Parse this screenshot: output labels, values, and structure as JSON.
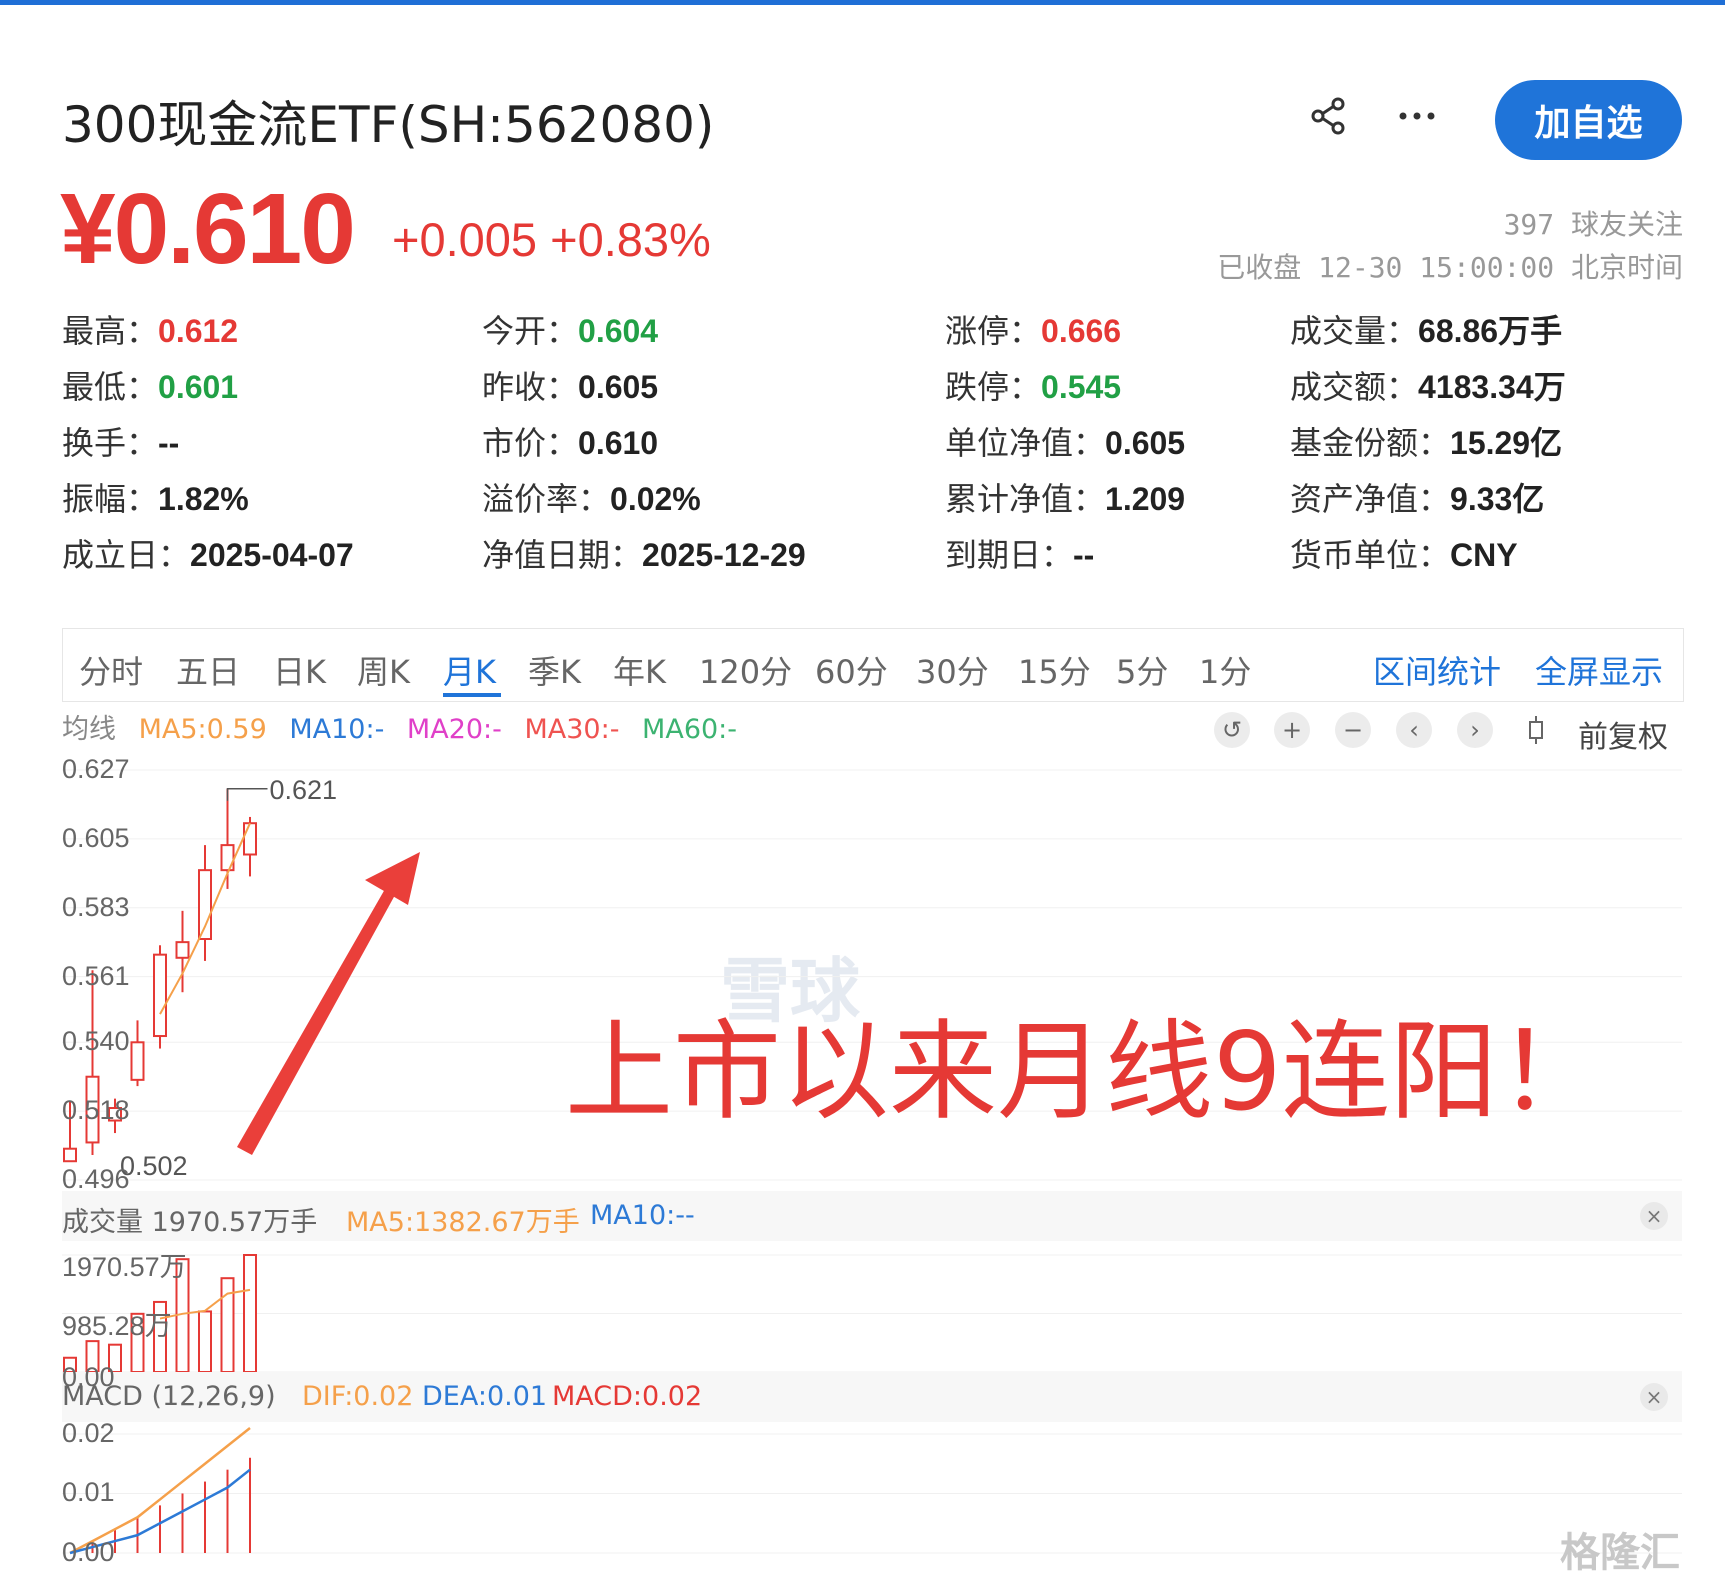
{
  "header": {
    "title": "300现金流ETF(SH:562080)",
    "add_label": "加自选",
    "share_icon": "share-icon",
    "more_icon": "more-icon",
    "price": "¥0.610",
    "change": "+0.005 +0.83%",
    "followers": "397 球友关注",
    "status": "已收盘 12-30 15:00:00 北京时间"
  },
  "stats": [
    {
      "label": "最高：",
      "value": "0.612",
      "color": "up"
    },
    {
      "label": "今开：",
      "value": "0.604",
      "color": "down"
    },
    {
      "label": "涨停：",
      "value": "0.666",
      "color": "up"
    },
    {
      "label": "成交量：",
      "value": "68.86万手",
      "color": "flat"
    },
    {
      "label": "最低：",
      "value": "0.601",
      "color": "down"
    },
    {
      "label": "昨收：",
      "value": "0.605",
      "color": "flat"
    },
    {
      "label": "跌停：",
      "value": "0.545",
      "color": "down"
    },
    {
      "label": "成交额：",
      "value": "4183.34万",
      "color": "flat"
    },
    {
      "label": "换手：",
      "value": "--",
      "color": "flat"
    },
    {
      "label": "市价：",
      "value": "0.610",
      "color": "flat"
    },
    {
      "label": "单位净值：",
      "value": "0.605",
      "color": "flat"
    },
    {
      "label": "基金份额：",
      "value": "15.29亿",
      "color": "flat"
    },
    {
      "label": "振幅：",
      "value": "1.82%",
      "color": "flat"
    },
    {
      "label": "溢价率：",
      "value": "0.02%",
      "color": "flat"
    },
    {
      "label": "累计净值：",
      "value": "1.209",
      "color": "flat"
    },
    {
      "label": "资产净值：",
      "value": "9.33亿",
      "color": "flat"
    },
    {
      "label": "成立日：",
      "value": "2025-04-07",
      "color": "flat"
    },
    {
      "label": "净值日期：",
      "value": "2025-12-29",
      "color": "flat"
    },
    {
      "label": "到期日：",
      "value": "--",
      "color": "flat"
    },
    {
      "label": "货币单位：",
      "value": "CNY",
      "color": "flat"
    }
  ],
  "tabs": [
    "分时",
    "五日",
    "日K",
    "周K",
    "月K",
    "季K",
    "年K",
    "120分",
    "60分",
    "30分",
    "15分",
    "5分",
    "1分"
  ],
  "active_tab": "月K",
  "tab_links": [
    "区间统计",
    "全屏显示"
  ],
  "ma_legend": {
    "label": "均线",
    "ma5": "MA5:0.59",
    "ma10": "MA10:-",
    "ma20": "MA20:-",
    "ma30": "MA30:-",
    "ma60": "MA60:-"
  },
  "toolbar": {
    "undo_icon": "undo-icon",
    "zoom_in_icon": "zoom-in-icon",
    "zoom_out_icon": "zoom-out-icon",
    "prev_icon": "chevron-left-icon",
    "next_icon": "chevron-right-icon",
    "candle_icon": "candle-icon",
    "adjust_label": "前复权"
  },
  "volume_panel": {
    "label": "成交量 1970.57万手",
    "ma5": "MA5:1382.67万手",
    "ma10": "MA10:--",
    "ticks": [
      "1970.57万",
      "985.28万",
      "0.00"
    ]
  },
  "macd_panel": {
    "label": "MACD (12,26,9)",
    "dif": "DIF:0.02",
    "dea": "DEA:0.01",
    "macd": "MACD:0.02",
    "ticks": [
      "0.02",
      "0.01",
      "0.00"
    ]
  },
  "annotation": "上市以来月线9连阳！",
  "watermark": "雪球",
  "logo": "格隆汇",
  "colors": {
    "up": "#e53935",
    "down": "#21a045",
    "accent": "#1f74d9",
    "ma5": "#f5a04a",
    "ma10": "#2d7ad6",
    "ma20": "#e040c8",
    "ma30": "#ef5350",
    "ma60": "#3cb371"
  },
  "chart_data": [
    {
      "type": "candlestick",
      "title": "",
      "y_ticks": [
        "0.627",
        "0.605",
        "0.583",
        "0.561",
        "0.540",
        "0.518",
        "0.496"
      ],
      "max_label": "0.621",
      "min_label": "0.502",
      "candles": [
        {
          "open": 0.502,
          "close": 0.506,
          "high": 0.521,
          "low": 0.502
        },
        {
          "open": 0.508,
          "close": 0.529,
          "high": 0.563,
          "low": 0.504
        },
        {
          "open": 0.515,
          "close": 0.519,
          "high": 0.522,
          "low": 0.511
        },
        {
          "open": 0.528,
          "close": 0.54,
          "high": 0.547,
          "low": 0.526
        },
        {
          "open": 0.542,
          "close": 0.568,
          "high": 0.571,
          "low": 0.538
        },
        {
          "open": 0.567,
          "close": 0.572,
          "high": 0.582,
          "low": 0.556
        },
        {
          "open": 0.573,
          "close": 0.595,
          "high": 0.603,
          "low": 0.566
        },
        {
          "open": 0.595,
          "close": 0.603,
          "high": 0.621,
          "low": 0.589
        },
        {
          "open": 0.6,
          "close": 0.61,
          "high": 0.612,
          "low": 0.593
        }
      ],
      "ma5": [
        null,
        null,
        null,
        null,
        0.549,
        0.562,
        0.577,
        0.594,
        0.61
      ]
    },
    {
      "type": "bar",
      "title": "",
      "values": [
        240,
        520,
        460,
        980,
        1180,
        1900,
        1020,
        1580,
        1970.57
      ],
      "ma5": [
        null,
        null,
        null,
        null,
        900,
        980,
        1030,
        1320,
        1382.67
      ]
    },
    {
      "type": "line",
      "title": "",
      "series": [
        {
          "name": "DIF",
          "values": [
            0.0,
            0.002,
            0.004,
            0.006,
            0.009,
            0.012,
            0.015,
            0.018,
            0.021
          ]
        },
        {
          "name": "DEA",
          "values": [
            0.0,
            0.001,
            0.002,
            0.003,
            0.005,
            0.007,
            0.009,
            0.011,
            0.014
          ]
        },
        {
          "name": "MACD",
          "values": [
            0.0,
            0.002,
            0.004,
            0.006,
            0.008,
            0.01,
            0.012,
            0.014,
            0.016
          ]
        }
      ]
    }
  ]
}
